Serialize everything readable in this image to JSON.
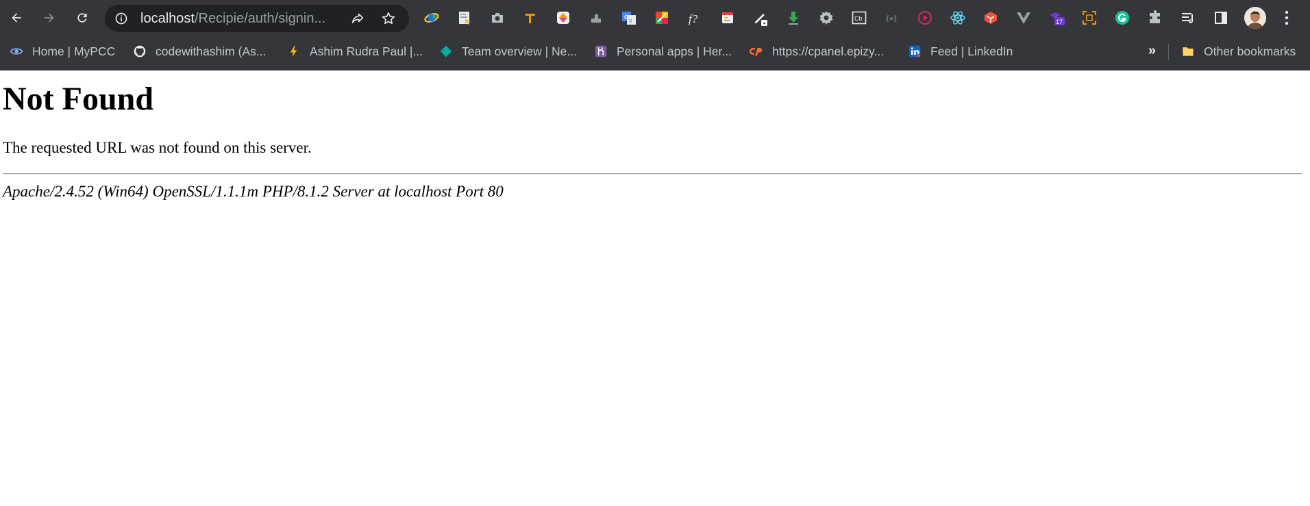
{
  "browser": {
    "url_host": "localhost",
    "url_path": "/Recipie/auth/signin...",
    "extensions": [
      {
        "name": "ie-tab-icon",
        "color": "#f9c642"
      },
      {
        "name": "page-ruler-icon",
        "color": "#f5c24d"
      },
      {
        "name": "screenshot-camera-icon",
        "color": "#bdc1c6"
      },
      {
        "name": "measure-tool-icon",
        "color": "#f29900"
      },
      {
        "name": "colorzilla-icon",
        "color": "#e040a0"
      },
      {
        "name": "stack-icon",
        "color": "#9aa0a6"
      },
      {
        "name": "google-translate-icon",
        "color": "#4285f4"
      },
      {
        "name": "color-palette-icon",
        "color": "#34a853"
      },
      {
        "name": "font-finder-icon",
        "color": "#e8eaed"
      },
      {
        "name": "calendar-icon",
        "color": "#ea4335"
      },
      {
        "name": "pen-tool-icon",
        "color": "#e8eaed"
      },
      {
        "name": "download-arrow-icon",
        "color": "#34a853"
      },
      {
        "name": "gear-icon",
        "color": "#bdc1c6"
      },
      {
        "name": "coinbase-icon",
        "color": "#e8eaed"
      },
      {
        "name": "json-viewer-icon",
        "color": "#9aa0a6"
      },
      {
        "name": "play-circle-icon",
        "color": "#e0245e"
      },
      {
        "name": "react-devtools-icon",
        "color": "#61dafb"
      },
      {
        "name": "laravel-icon",
        "color": "#f05340"
      },
      {
        "name": "vue-devtools-icon",
        "color": "#9aa0a6"
      },
      {
        "name": "wappalyzer-icon",
        "color": "#6c3bd4"
      },
      {
        "name": "crop-tool-icon",
        "color": "#f29900"
      },
      {
        "name": "grammarly-icon",
        "color": "#15c39a"
      },
      {
        "name": "puzzle-extensions-icon",
        "color": "#bdc1c6"
      }
    ],
    "calendar_badge": "17",
    "bookmarks": [
      {
        "label": "Home | MyPCC",
        "icon": "mypcc-icon"
      },
      {
        "label": "codewithashim (As...",
        "icon": "github-icon"
      },
      {
        "label": "Ashim Rudra Paul |...",
        "icon": "lightning-icon"
      },
      {
        "label": "Team overview | Ne...",
        "icon": "diamond-icon"
      },
      {
        "label": "Personal apps | Her...",
        "icon": "heroku-icon"
      },
      {
        "label": "https://cpanel.epizy...",
        "icon": "cpanel-icon"
      },
      {
        "label": "Feed | LinkedIn",
        "icon": "linkedin-icon"
      }
    ],
    "overflow_label": "»",
    "other_bookmarks_label": "Other bookmarks"
  },
  "page": {
    "heading": "Not Found",
    "message": "The requested URL was not found on this server.",
    "server_signature": "Apache/2.4.52 (Win64) OpenSSL/1.1.1m PHP/8.1.2 Server at localhost Port 80"
  }
}
